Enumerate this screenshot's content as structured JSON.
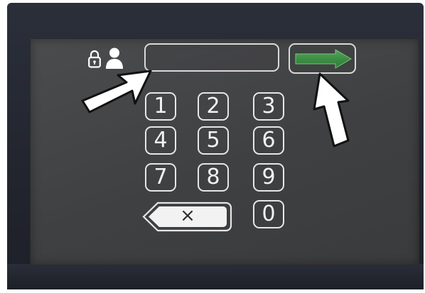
{
  "device": {
    "screen_color": "#444547",
    "accent_green": "#3f9a4a"
  },
  "header": {
    "lock_icon": "padlock-icon",
    "user_icon": "user-icon"
  },
  "entry": {
    "value": ""
  },
  "submit": {
    "icon": "right-arrow-icon"
  },
  "keypad": {
    "keys": [
      "1",
      "2",
      "3",
      "4",
      "5",
      "6",
      "7",
      "8",
      "9",
      "0"
    ],
    "backspace_label": "×"
  },
  "annotations": {
    "arrow_color": "#ffffff"
  }
}
